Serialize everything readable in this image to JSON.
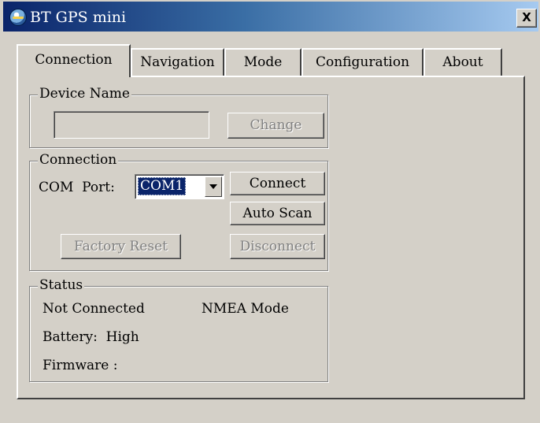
{
  "window": {
    "title": "BT GPS mini",
    "close_symbol": "X"
  },
  "tabs": [
    {
      "label": "Connection",
      "active": true
    },
    {
      "label": "Navigation",
      "active": false
    },
    {
      "label": "Mode",
      "active": false
    },
    {
      "label": "Configuration",
      "active": false
    },
    {
      "label": "About",
      "active": false
    }
  ],
  "device_name_group": {
    "title": "Device Name",
    "name_value": "",
    "change_button": "Change",
    "change_enabled": false
  },
  "connection_group": {
    "title": "Connection",
    "com_port_label": "COM  Port:",
    "com_port_value": "COM1",
    "connect_button": "Connect",
    "auto_scan_button": "Auto Scan",
    "factory_reset_button": "Factory Reset",
    "disconnect_button": "Disconnect",
    "factory_reset_enabled": false,
    "disconnect_enabled": false
  },
  "status_group": {
    "title": "Status",
    "connection_status": "Not Connected",
    "mode_status": "NMEA Mode",
    "battery": "Battery:  High",
    "firmware": "Firmware :"
  },
  "icons": {
    "app": "gps-globe-icon",
    "close": "close-icon",
    "dropdown": "chevron-down-icon"
  },
  "colors": {
    "titlebar_start": "#0a246a",
    "titlebar_end": "#a6caf0",
    "face": "#d4d0c8",
    "selection": "#0a246a"
  }
}
